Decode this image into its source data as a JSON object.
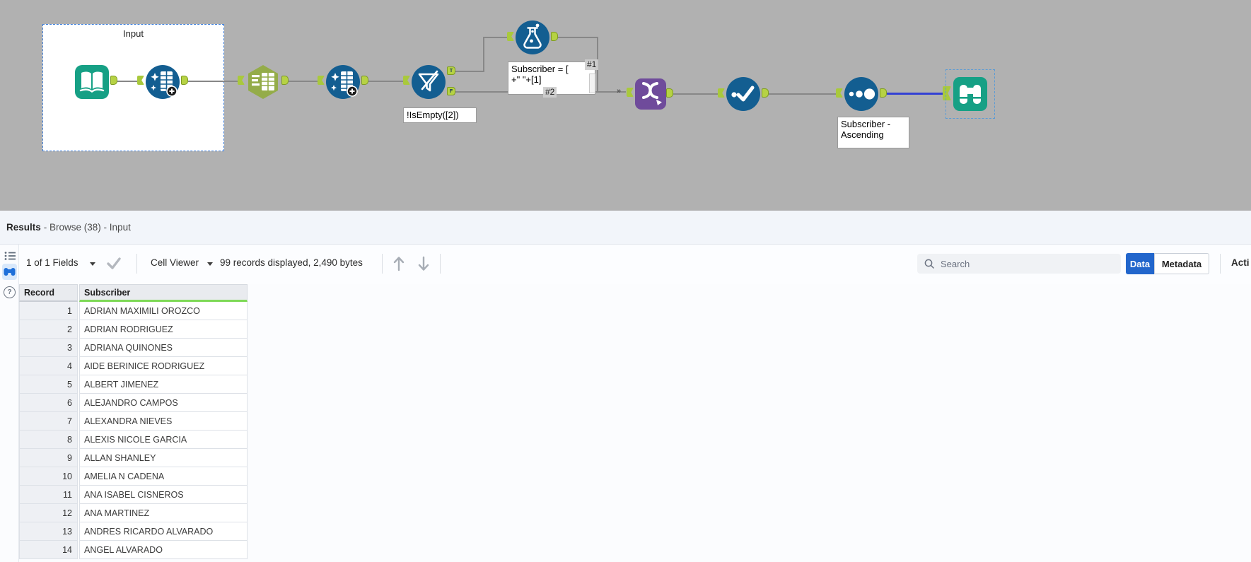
{
  "canvas": {
    "container_label": "Input",
    "multi_input_marker": "»",
    "filter_ports": {
      "true_label": "T",
      "false_label": "F"
    },
    "connection_labels": {
      "first": "#1",
      "second": "#2"
    },
    "annotations": {
      "filter": "!IsEmpty([2])",
      "formula_line1": "Subscriber = [",
      "formula_line2": "+\" \"+[1]",
      "sort_line1": "Subscriber -",
      "sort_line2": "Ascending"
    },
    "tools": [
      "input-data",
      "data-cleansing",
      "text-to-columns",
      "data-cleansing",
      "filter",
      "formula",
      "union",
      "unique",
      "sort",
      "browse"
    ],
    "colors": {
      "canvas_gray": "#b1b1b1",
      "tool_blue": "#135e91",
      "tool_teal": "#16a085",
      "tool_green": "#94ac49",
      "tool_purple": "#6f4b9b",
      "port_green": "#b6d244",
      "selected_connection": "#3340d4",
      "data_button_blue": "#2266cc",
      "string_type_green": "#7ed957"
    }
  },
  "results": {
    "title": "Results",
    "title_suffix": "- Browse (38) - Input",
    "toolbar": {
      "fields": "1 of 1 Fields",
      "cell_viewer": "Cell Viewer",
      "records": "99 records displayed, 2,490 bytes",
      "search_placeholder": "Search",
      "data_btn": "Data",
      "metadata_btn": "Metadata",
      "actions_partial": "Acti"
    },
    "table": {
      "columns": [
        "Record",
        "Subscriber"
      ],
      "rows": [
        {
          "n": "1",
          "s": "ADRIAN MAXIMILI OROZCO"
        },
        {
          "n": "2",
          "s": "ADRIAN RODRIGUEZ"
        },
        {
          "n": "3",
          "s": "ADRIANA QUINONES"
        },
        {
          "n": "4",
          "s": "AIDE BERINICE RODRIGUEZ"
        },
        {
          "n": "5",
          "s": "ALBERT JIMENEZ"
        },
        {
          "n": "6",
          "s": "ALEJANDRO CAMPOS"
        },
        {
          "n": "7",
          "s": "ALEXANDRA NIEVES"
        },
        {
          "n": "8",
          "s": "ALEXIS NICOLE GARCIA"
        },
        {
          "n": "9",
          "s": "ALLAN SHANLEY"
        },
        {
          "n": "10",
          "s": "AMELIA N CADENA"
        },
        {
          "n": "11",
          "s": "ANA ISABEL CISNEROS"
        },
        {
          "n": "12",
          "s": "ANA MARTINEZ"
        },
        {
          "n": "13",
          "s": "ANDRES RICARDO ALVARADO"
        },
        {
          "n": "14",
          "s": "ANGEL ALVARADO"
        }
      ]
    }
  }
}
